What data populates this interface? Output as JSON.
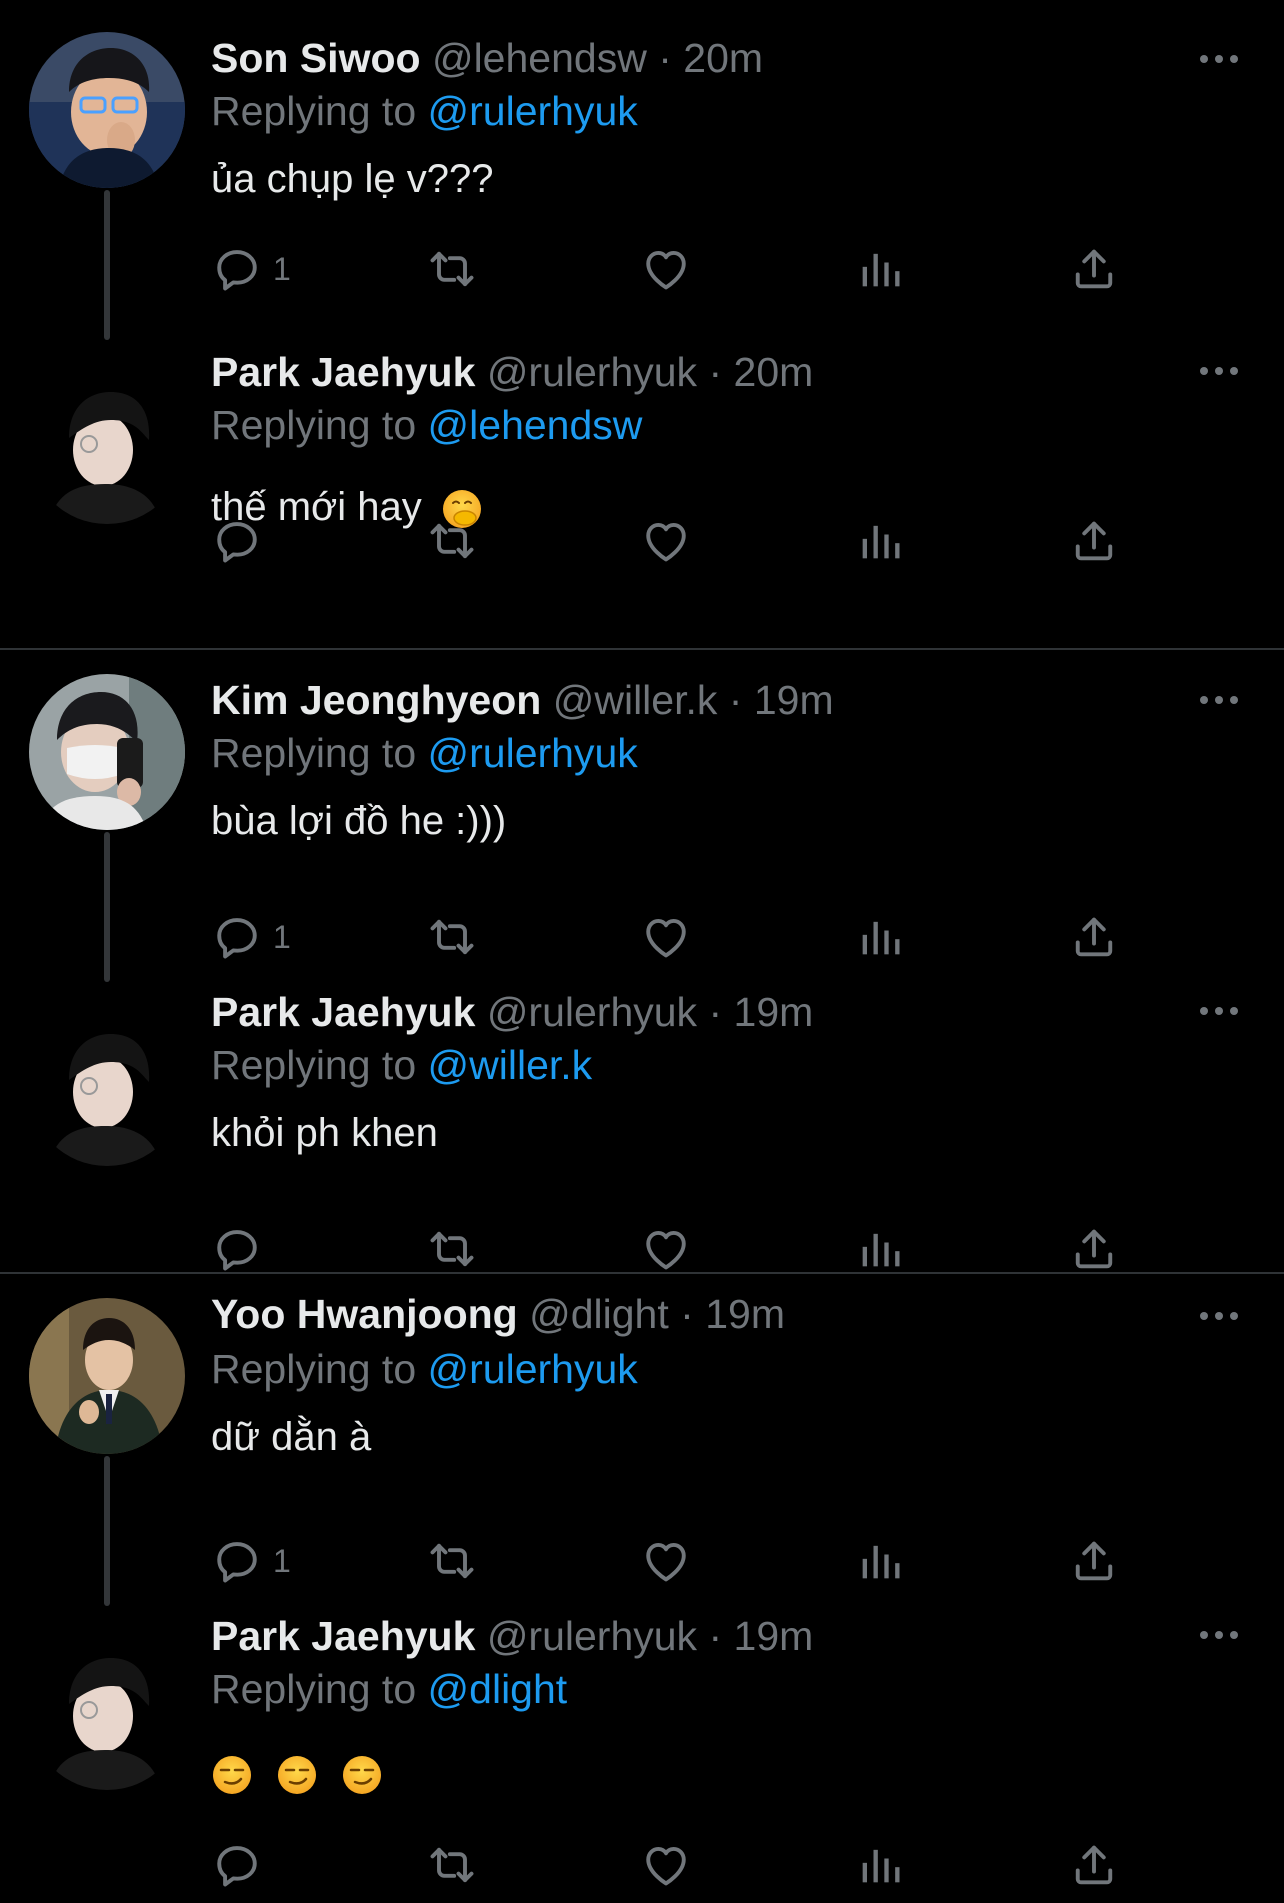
{
  "tweets": [
    {
      "name": "Son Siwoo",
      "handle": "@lehendsw",
      "time": "20m",
      "reply_label": "Replying to",
      "reply_to": "@rulerhyuk",
      "text": "ủa chụp lẹ v???",
      "reply_count": "1"
    },
    {
      "name": "Park Jaehyuk",
      "handle": "@rulerhyuk",
      "time": "20m",
      "reply_label": "Replying to",
      "reply_to": "@lehendsw",
      "text": "thế mới hay",
      "emoji": "face-with-hand-over-mouth",
      "reply_count": ""
    },
    {
      "name": "Kim Jeonghyeon",
      "handle": "@willer.k",
      "time": "19m",
      "reply_label": "Replying to",
      "reply_to": "@rulerhyuk",
      "text": "bùa lợi đồ he :)))",
      "reply_count": "1"
    },
    {
      "name": "Park Jaehyuk",
      "handle": "@rulerhyuk",
      "time": "19m",
      "reply_label": "Replying to",
      "reply_to": "@willer.k",
      "text": "khỏi ph khen",
      "reply_count": ""
    },
    {
      "name": "Yoo Hwanjoong",
      "handle": "@dlight",
      "time": "19m",
      "reply_label": "Replying to",
      "reply_to": "@rulerhyuk",
      "text": "dữ dằn à",
      "reply_count": "1"
    },
    {
      "name": "Park Jaehyuk",
      "handle": "@rulerhyuk",
      "time": "19m",
      "reply_label": "Replying to",
      "reply_to": "@dlight",
      "text": "",
      "emoji": "smirking-face x3",
      "reply_count": ""
    }
  ],
  "separator": "·",
  "colors": {
    "background": "#000000",
    "text": "#e7e9ea",
    "secondary": "#71767b",
    "accent": "#1d9bf0",
    "divider": "#2f3336"
  },
  "icons": [
    "reply-icon",
    "retweet-icon",
    "like-icon",
    "views-icon",
    "share-icon",
    "more-icon"
  ]
}
